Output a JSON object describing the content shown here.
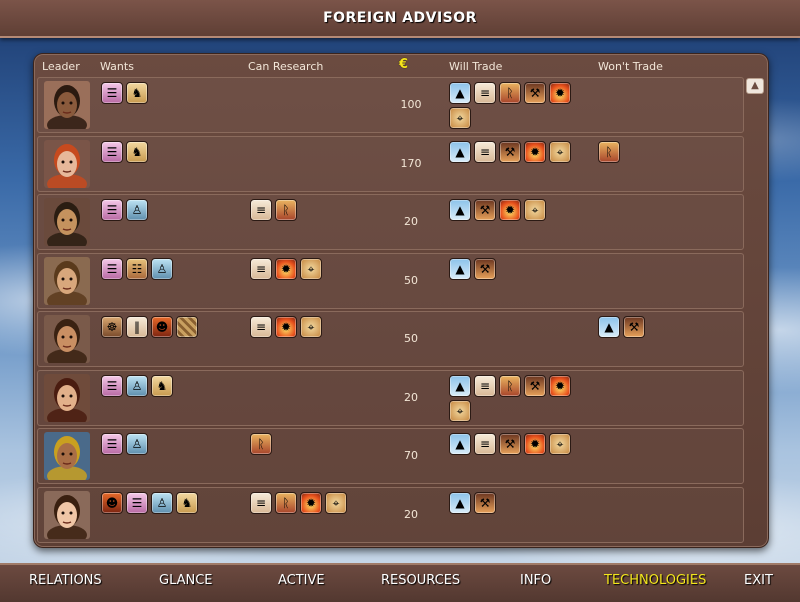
{
  "window": {
    "title": "FOREIGN ADVISOR"
  },
  "headers": {
    "leader": "Leader",
    "wants": "Wants",
    "can_research": "Can Research",
    "gold_icon": "gold-coin-icon",
    "will_trade": "Will Trade",
    "wont_trade": "Won't Trade"
  },
  "rows": [
    {
      "gold": "100",
      "wants": [
        "pink-scroll-icon",
        "horse-icon"
      ],
      "can_research": [],
      "will_trade": [
        "pyramid-icon",
        "scroll-icon",
        "rune-icon",
        "bronze-icon",
        "fire-icon",
        "compass-icon"
      ],
      "wont_trade": []
    },
    {
      "gold": "170",
      "wants": [
        "pink-scroll-icon",
        "horse-icon"
      ],
      "can_research": [],
      "will_trade": [
        "pyramid-icon",
        "scroll-icon",
        "bronze-icon",
        "fire-icon",
        "compass-icon"
      ],
      "wont_trade": [
        "rune-icon"
      ]
    },
    {
      "gold": "20",
      "wants": [
        "pink-scroll-icon",
        "statue-icon"
      ],
      "can_research": [
        "scroll-icon",
        "rune-icon"
      ],
      "will_trade": [
        "pyramid-icon",
        "bronze-icon",
        "fire-icon",
        "compass-icon"
      ],
      "wont_trade": []
    },
    {
      "gold": "50",
      "wants": [
        "pink-scroll-icon",
        "script-icon",
        "statue-icon"
      ],
      "can_research": [
        "scroll-icon",
        "fire-icon",
        "compass-icon"
      ],
      "will_trade": [
        "pyramid-icon",
        "bronze-icon"
      ],
      "wont_trade": []
    },
    {
      "gold": "50",
      "wants": [
        "wheel-icon",
        "pillar-icon",
        "mask-icon",
        "mosaic-icon"
      ],
      "can_research": [
        "scroll-icon",
        "fire-icon",
        "compass-icon"
      ],
      "will_trade": [],
      "wont_trade": [
        "pyramid-icon",
        "bronze-icon"
      ]
    },
    {
      "gold": "20",
      "wants": [
        "pink-scroll-icon",
        "statue-icon",
        "horse-icon"
      ],
      "can_research": [],
      "will_trade": [
        "pyramid-icon",
        "scroll-icon",
        "rune-icon",
        "bronze-icon",
        "fire-icon",
        "compass-icon"
      ],
      "wont_trade": []
    },
    {
      "gold": "70",
      "wants": [
        "pink-scroll-icon",
        "statue-icon"
      ],
      "can_research": [
        "rune-icon"
      ],
      "will_trade": [
        "pyramid-icon",
        "scroll-icon",
        "bronze-icon",
        "fire-icon",
        "compass-icon"
      ],
      "wont_trade": []
    },
    {
      "gold": "20",
      "wants": [
        "mask-icon",
        "pink-scroll-icon",
        "statue-icon",
        "horse-icon"
      ],
      "can_research": [
        "scroll-icon",
        "rune-icon",
        "fire-icon",
        "compass-icon"
      ],
      "will_trade": [
        "pyramid-icon",
        "bronze-icon"
      ],
      "wont_trade": []
    }
  ],
  "tabs": [
    {
      "label": "RELATIONS",
      "active": false
    },
    {
      "label": "GLANCE",
      "active": false
    },
    {
      "label": "ACTIVE",
      "active": false
    },
    {
      "label": "RESOURCES",
      "active": false
    },
    {
      "label": "INFO",
      "active": false
    },
    {
      "label": "TECHNOLOGIES",
      "active": true
    },
    {
      "label": "EXIT",
      "active": false
    }
  ],
  "colors": {
    "active_tab": "#f3e61c",
    "panel": "#6b4b40",
    "title_text": "#ffffff"
  }
}
